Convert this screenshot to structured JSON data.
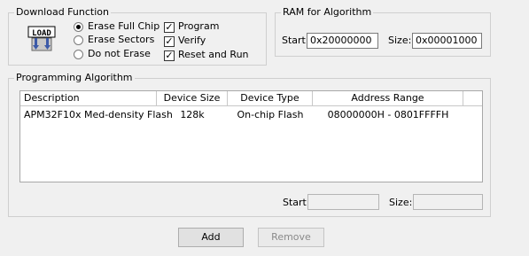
{
  "download": {
    "title": "Download Function",
    "options": [
      "Erase Full Chip",
      "Erase Sectors",
      "Do not Erase"
    ],
    "selected": "Erase Full Chip",
    "checks": [
      {
        "label": "Program",
        "checked": true
      },
      {
        "label": "Verify",
        "checked": true
      },
      {
        "label": "Reset and Run",
        "checked": true
      }
    ],
    "icon_text": "LOAD",
    "icon": "load-icon"
  },
  "ram": {
    "title": "RAM for Algorithm",
    "start_label": "Start:",
    "start_value": "0x20000000",
    "size_label": "Size:",
    "size_value": "0x00001000"
  },
  "algorithm": {
    "title": "Programming Algorithm",
    "columns": [
      "Description",
      "Device Size",
      "Device Type",
      "Address Range"
    ],
    "rows": [
      {
        "description": "APM32F10x Med-density Flash",
        "size": "128k",
        "type": "On-chip Flash",
        "range": "08000000H - 0801FFFFH"
      }
    ],
    "start_label": "Start:",
    "start_value": "",
    "size_label": "Size:",
    "size_value": ""
  },
  "buttons": {
    "add": "Add",
    "remove": "Remove"
  }
}
